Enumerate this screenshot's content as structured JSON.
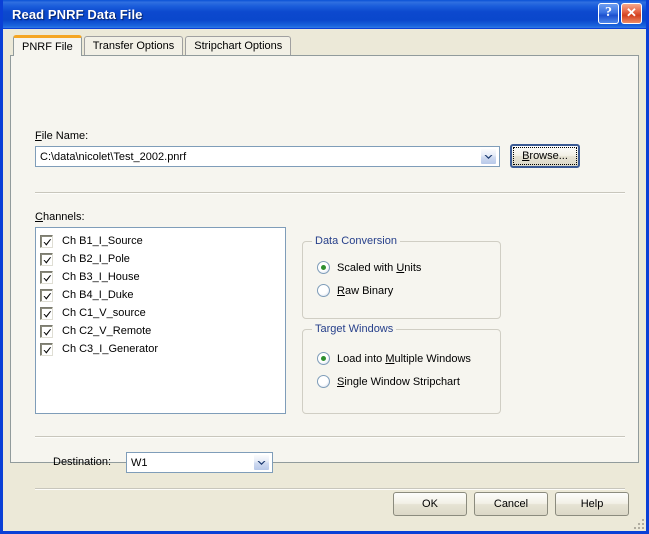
{
  "window": {
    "title": "Read PNRF Data File",
    "help_button": "?",
    "close_button": "✕"
  },
  "tabs": [
    {
      "label": "PNRF File",
      "active": true
    },
    {
      "label": "Transfer Options",
      "active": false
    },
    {
      "label": "Stripchart Options",
      "active": false
    }
  ],
  "file_section": {
    "label_prefix": "F",
    "label_rest": "ile Name:",
    "value": "C:\\data\\nicolet\\Test_2002.pnrf",
    "browse_button": "Browse..."
  },
  "channels": {
    "label_prefix": "C",
    "label_rest": "hannels:",
    "items": [
      {
        "label": "Ch B1_I_Source",
        "checked": true
      },
      {
        "label": "Ch B2_I_Pole",
        "checked": true
      },
      {
        "label": "Ch B3_I_House",
        "checked": true
      },
      {
        "label": "Ch B4_I_Duke",
        "checked": true
      },
      {
        "label": "Ch C1_V_source",
        "checked": true
      },
      {
        "label": "Ch C2_V_Remote",
        "checked": true
      },
      {
        "label": "Ch C3_I_Generator",
        "checked": true
      }
    ]
  },
  "data_conversion": {
    "legend": "Data Conversion",
    "options": [
      {
        "pre": "Scaled with ",
        "acc": "U",
        "post": "nits",
        "selected": true
      },
      {
        "pre": "",
        "acc": "R",
        "post": "aw Binary",
        "selected": false
      }
    ]
  },
  "target_windows": {
    "legend": "Target Windows",
    "options": [
      {
        "pre": "Load into ",
        "acc": "M",
        "post": "ultiple Windows",
        "selected": true
      },
      {
        "pre": "",
        "acc": "S",
        "post": "ingle Window Stripchart",
        "selected": false
      }
    ]
  },
  "destination": {
    "label": "Destination:",
    "value": "W1"
  },
  "footer": {
    "ok": "OK",
    "cancel": "Cancel",
    "help": "Help"
  },
  "colors": {
    "titlebar_blue": "#0c49ce",
    "frame_blue": "#0a3fd6",
    "dialog_face": "#ece9d8",
    "tab_page": "#f6f5ef",
    "active_tab_accent": "#f5a623",
    "group_legend": "#27408b",
    "radio_dot_green": "#2f8f2f",
    "close_button_red": "#d2401f"
  }
}
